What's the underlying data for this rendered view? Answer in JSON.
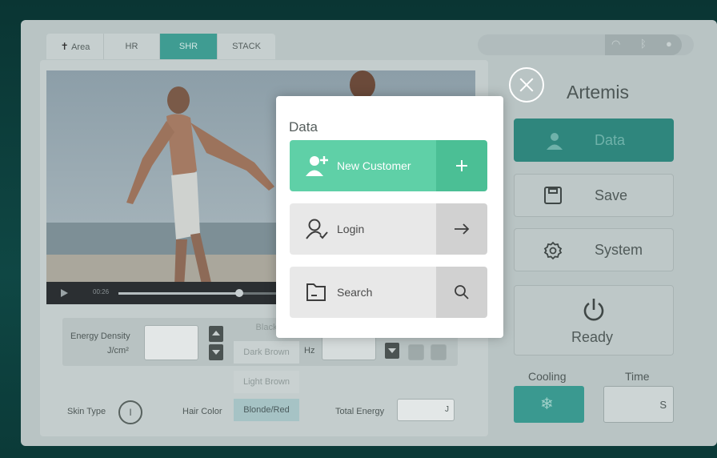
{
  "tabs": [
    {
      "label": "Area",
      "active": false
    },
    {
      "label": "HR",
      "active": false
    },
    {
      "label": "SHR",
      "active": true
    },
    {
      "label": "STACK",
      "active": false
    }
  ],
  "video": {
    "time": "00:26",
    "progress": 0.75
  },
  "settings": {
    "energy_density_label": "Energy Density",
    "energy_density_unit": "J/cm²",
    "hz_label": "Hz",
    "skin_type_label": "Skin Type",
    "skin_type_value": "I",
    "hair_color_label": "Hair Color",
    "hair_options": [
      "Black",
      "Dark Brown",
      "Light Brown",
      "Blonde/Red"
    ],
    "hair_selected": "Blonde/Red",
    "total_energy_label": "Total Energy",
    "total_energy_unit": "J"
  },
  "sidebar": {
    "brand": "Artemis",
    "data_label": "Data",
    "save_label": "Save",
    "system_label": "System",
    "ready_label": "Ready",
    "cooling_label": "Cooling",
    "time_label": "Time",
    "time_unit": "S"
  },
  "modal": {
    "title": "Data",
    "buttons": [
      {
        "label": "New Customer",
        "icon": "add-user-icon",
        "action_icon": "plus-icon"
      },
      {
        "label": "Login",
        "icon": "user-check-icon",
        "action_icon": "arrow-right-icon"
      },
      {
        "label": "Search",
        "icon": "folder-icon",
        "action_icon": "search-icon"
      }
    ]
  },
  "colors": {
    "accent": "#5fd0a7",
    "teal": "#3a9990"
  }
}
